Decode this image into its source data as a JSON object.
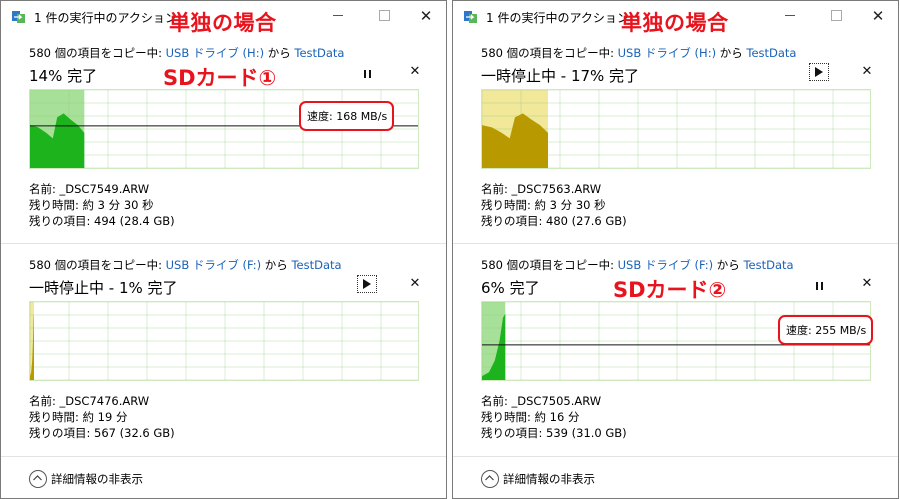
{
  "overlay": {
    "title": "単独の場合",
    "sd1": "SDカード①",
    "sd2": "SDカード②"
  },
  "windows": [
    {
      "title": "1 件の実行中のアクション",
      "ops": [
        {
          "copy_prefix": "580 個の項目をコピー中: ",
          "source": "USB ドライブ (H:)",
          "from": " から ",
          "dest": "TestData",
          "status": "14% 完了",
          "state": "running",
          "progress_percent": 14,
          "speed": "速度: 168 MB/s",
          "name": "名前:  _DSC7549.ARW",
          "time_left": "残り時間:  約 3 分 30 秒",
          "items_left": "残りの項目:  494 (28.4 GB)"
        },
        {
          "copy_prefix": "580 個の項目をコピー中: ",
          "source": "USB ドライブ (F:)",
          "from": " から ",
          "dest": "TestData",
          "status": "一時停止中 - 1% 完了",
          "state": "paused",
          "progress_percent": 1,
          "name": "名前:  _DSC7476.ARW",
          "time_left": "残り時間:  約 19 分",
          "items_left": "残りの項目:  567 (32.6 GB)"
        }
      ],
      "footer": "詳細情報の非表示"
    },
    {
      "title": "1 件の実行中のアクション",
      "ops": [
        {
          "copy_prefix": "580 個の項目をコピー中: ",
          "source": "USB ドライブ (H:)",
          "from": " から ",
          "dest": "TestData",
          "status": "一時停止中 - 17% 完了",
          "state": "paused",
          "progress_percent": 17,
          "name": "名前:  _DSC7563.ARW",
          "time_left": "残り時間:  約 3 分 30 秒",
          "items_left": "残りの項目:  480 (27.6 GB)"
        },
        {
          "copy_prefix": "580 個の項目をコピー中: ",
          "source": "USB ドライブ (F:)",
          "from": " から ",
          "dest": "TestData",
          "status": "6% 完了",
          "state": "running",
          "progress_percent": 6,
          "speed": "速度: 255 MB/s",
          "name": "名前:  _DSC7505.ARW",
          "time_left": "残り時間:  約 16 分",
          "items_left": "残りの項目:  539 (31.0 GB)"
        }
      ],
      "footer": "詳細情報の非表示"
    }
  ],
  "colors": {
    "accent_red": "#e8131c",
    "link": "#1a62b8",
    "running_light": "#a7e199",
    "running_dark": "#1db31d",
    "paused_light": "#f1e89a",
    "paused_dark": "#b89a00"
  },
  "icons": [
    "copy-app-icon",
    "minimize-icon",
    "maximize-icon",
    "close-icon",
    "pause-icon",
    "resume-icon",
    "cancel-icon",
    "chevron-up-icon"
  ]
}
